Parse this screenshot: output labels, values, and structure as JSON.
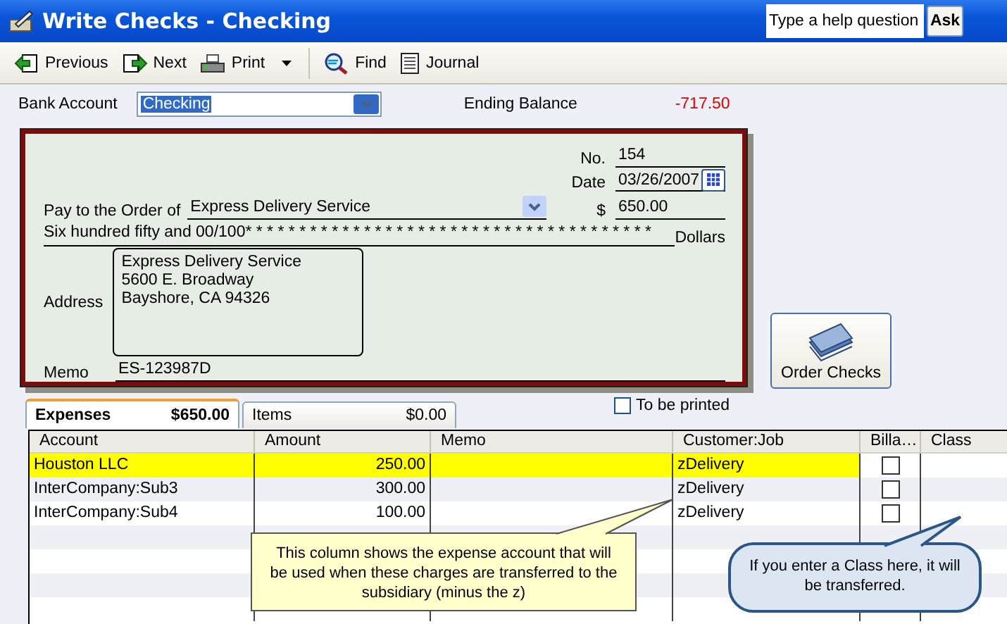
{
  "window": {
    "title": "Write Checks - Checking"
  },
  "help": {
    "placeholder": "Type a help question",
    "button": "Ask"
  },
  "toolbar": [
    {
      "kind": "previous",
      "label": "Previous"
    },
    {
      "kind": "next",
      "label": "Next"
    },
    {
      "kind": "print",
      "label": "Print",
      "dropdown": true
    },
    {
      "kind": "find",
      "label": "Find"
    },
    {
      "kind": "journal",
      "label": "Journal"
    }
  ],
  "bank_account": {
    "label": "Bank Account",
    "value": "Checking"
  },
  "ending_balance": {
    "label": "Ending Balance",
    "value": "-717.50"
  },
  "check": {
    "number_label": "No.",
    "number": "154",
    "date_label": "Date",
    "date": "03/26/2007",
    "pay_to_label": "Pay to the Order of",
    "payee": "Express Delivery Service",
    "amount_label": "$",
    "amount": "650.00",
    "amount_words": "Six hundred fifty and 00/100* * * * * * * * * * * * * * * * * * * * * * * * * * * * * * * * * * * * * *",
    "dollars_label": "Dollars",
    "address_label": "Address",
    "address": [
      "Express Delivery Service",
      "5600 E. Broadway",
      "Bayshore, CA 94326"
    ],
    "memo_label": "Memo",
    "memo": "ES-123987D"
  },
  "order_checks": {
    "label": "Order Checks"
  },
  "tabs": [
    {
      "label": "Expenses",
      "amount": "$650.00",
      "selected": true
    },
    {
      "label": "Items",
      "amount": "$0.00",
      "selected": false
    }
  ],
  "to_be_printed": {
    "label": "To be printed",
    "checked": false
  },
  "table": {
    "columns": [
      "Account",
      "Amount",
      "Memo",
      "Customer:Job",
      "Billa…",
      "Class"
    ],
    "rows": [
      {
        "account": "Houston LLC",
        "amount": "250.00",
        "customer_job": "zDelivery",
        "billable": false,
        "selected": true
      },
      {
        "account": "InterCompany:Sub3",
        "amount": "300.00",
        "customer_job": "zDelivery",
        "billable": false,
        "selected": false
      },
      {
        "account": "InterCompany:Sub4",
        "amount": "100.00",
        "customer_job": "zDelivery",
        "billable": false,
        "selected": false
      }
    ]
  },
  "callouts": [
    {
      "kind": "note",
      "text": "This column shows the expense account that will be used when these charges are transferred to the subsidiary (minus the z)"
    },
    {
      "kind": "bubble",
      "text": "If you enter a Class here, it will be transferred."
    }
  ]
}
